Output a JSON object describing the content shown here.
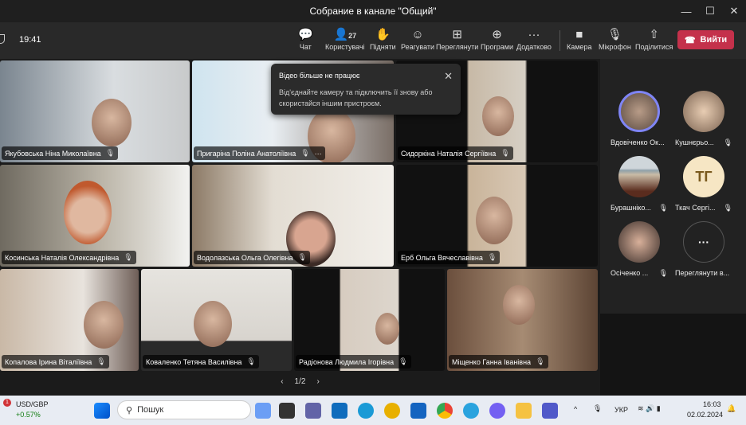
{
  "window": {
    "title": "Собрание в канале \"Общий\"",
    "minimize": "—",
    "maximize": "☐",
    "close": "✕"
  },
  "toolbar": {
    "time": "19:41",
    "participants_count": "27",
    "buttons": [
      {
        "label": "Чат",
        "icon": "💬"
      },
      {
        "label": "Користувачі",
        "icon": "👤"
      },
      {
        "label": "Підняти",
        "icon": "✋"
      },
      {
        "label": "Реагувати",
        "icon": "☺"
      },
      {
        "label": "Переглянути",
        "icon": "⊞"
      },
      {
        "label": "Програми",
        "icon": "⊕"
      },
      {
        "label": "Додатково",
        "icon": "···"
      },
      {
        "label": "Камера",
        "icon": "■"
      },
      {
        "label": "Мікрофон",
        "icon": "🎙"
      },
      {
        "label": "Поділитися",
        "icon": "⇧"
      }
    ],
    "leave": "Вийти"
  },
  "popup": {
    "title": "Відео більше не працює",
    "body": "Від'єднайте камеру та підключить її знову або скористайся іншим пристроєм."
  },
  "tiles": [
    "Якубовська Ніна Миколаївна",
    "Пригаріна Поліна Анатоліївна",
    "Сидоркіна Наталія Сергіївна",
    "Косинська Наталія Олександрівна",
    "Водолазська Ольга Олегівна",
    "Ерб Ольга Вячеславівна",
    "Копалова Ірина Віталіївна",
    "Коваленко Тетяна Василівна",
    "Радіонова Людмила Ігорівна",
    "Міщенко Ганна Іванівна"
  ],
  "pager": {
    "prev": "‹",
    "page": "1/2",
    "next": "›"
  },
  "sidebar": [
    {
      "name": "Вдовіченко Ок..."
    },
    {
      "name": "Кушнєрьо..."
    },
    {
      "name": "Бурашніко..."
    },
    {
      "name": "Ткач Сергі...",
      "initials": "ТГ"
    },
    {
      "name": "Осіченко ..."
    },
    {
      "name": "Переглянути в...",
      "initials": "···"
    }
  ],
  "taskbar": {
    "ticker": "USD/GBP",
    "change": "+0.57%",
    "badge": "1",
    "search": "Пошук",
    "lang": "УКР",
    "clock": "16:03",
    "date": "02.02.2024"
  }
}
